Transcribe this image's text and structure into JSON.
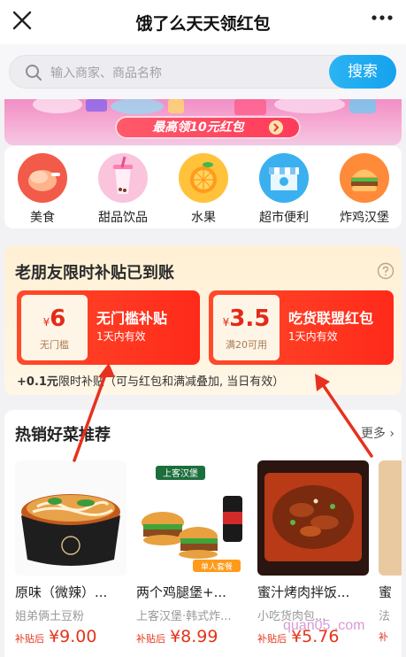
{
  "header": {
    "title": "饿了么天天领红包"
  },
  "search": {
    "placeholder": "输入商家、商品名称",
    "button": "搜索"
  },
  "banner": {
    "button": "最高领10元红包"
  },
  "categories": [
    {
      "label": "美食",
      "icon": "chicken-icon",
      "color": "#f25a4a"
    },
    {
      "label": "甜品饮品",
      "icon": "bubble-tea-icon",
      "color": "#f6a0c8"
    },
    {
      "label": "水果",
      "icon": "orange-icon",
      "color": "#ffb62a"
    },
    {
      "label": "超市便利",
      "icon": "store-icon",
      "color": "#3ab0f0"
    },
    {
      "label": "炸鸡汉堡",
      "icon": "burger-icon",
      "color": "#ff8a3a"
    }
  ],
  "subsidy": {
    "title": "老朋友限时补贴已到账",
    "coupons": [
      {
        "currency": "¥",
        "amount": "6",
        "condition": "无门槛",
        "name": "无门槛补贴",
        "validity": "1天内有效"
      },
      {
        "currency": "¥",
        "amount": "3.5",
        "condition": "满20可用",
        "name": "吃货联盟红包",
        "validity": "1天内有效"
      }
    ],
    "note_amount": "+0.1元",
    "note_text": "限时补贴（可与红包和满减叠加, 当日有效）"
  },
  "hot": {
    "title": "热销好菜推荐",
    "more": "更多",
    "dishes": [
      {
        "name": "原味（微辣）...",
        "shop": "姐弟俩土豆粉",
        "price_label": "补贴后",
        "price": "¥9.00"
      },
      {
        "name": "两个鸡腿堡+...",
        "shop": "上客汉堡·韩式炸...",
        "price_label": "补贴后",
        "price": "¥8.99"
      },
      {
        "name": "蜜汁烤肉拌饭...",
        "shop": "小吃货肉包...",
        "price_label": "补贴后",
        "price": "¥5.76"
      },
      {
        "name": "蜜",
        "shop": "法",
        "price_label": "补",
        "price": ""
      }
    ],
    "promo_label": "上客汉堡",
    "promo_sub": "单人套餐"
  },
  "watermark": "quan05 .com"
}
